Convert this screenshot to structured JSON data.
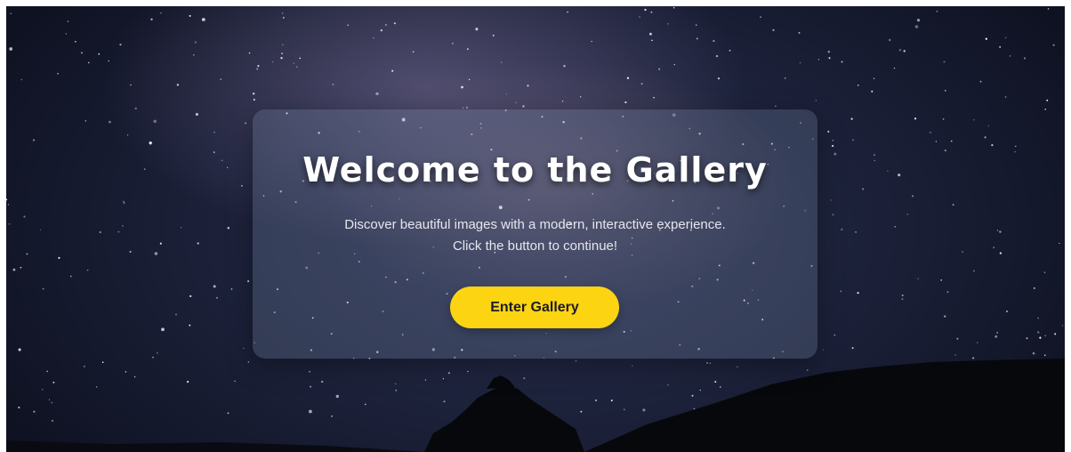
{
  "hero": {
    "title": "Welcome to the Gallery",
    "description_line1": "Discover beautiful images with a modern, interactive experience.",
    "description_line2": "Click the button to continue!",
    "enter_button_label": "Enter Gallery"
  },
  "colors": {
    "accent": "#fcd412",
    "background_dark": "#1b2038",
    "card_overlay": "rgba(120,135,165,0.28)"
  }
}
